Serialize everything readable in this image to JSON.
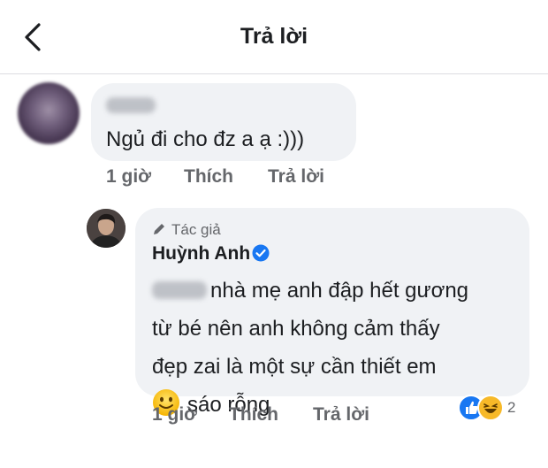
{
  "header": {
    "title": "Trả lời"
  },
  "comment": {
    "text": "Ngủ đi cho đz a ạ :)))",
    "actions": {
      "time": "1 giờ",
      "like": "Thích",
      "reply": "Trả lời"
    }
  },
  "reply": {
    "author_tag": "Tác giả",
    "author_name": "Huỳnh Anh",
    "lines": [
      "nhà mẹ anh đập hết gương",
      "từ bé nên anh không cảm thấy",
      "đẹp zai là một sự cần thiết em",
      "sáo rỗng"
    ],
    "actions": {
      "time": "1 giờ",
      "like": "Thích",
      "reply": "Trả lời"
    },
    "reactions": {
      "icons": [
        "like-icon",
        "haha-icon"
      ],
      "count": "2"
    }
  },
  "colors": {
    "bubble": "#f0f2f5",
    "meta_text": "#65676b",
    "verified": "#1877f2",
    "like": "#1877f2",
    "haha": "#f7b928"
  }
}
